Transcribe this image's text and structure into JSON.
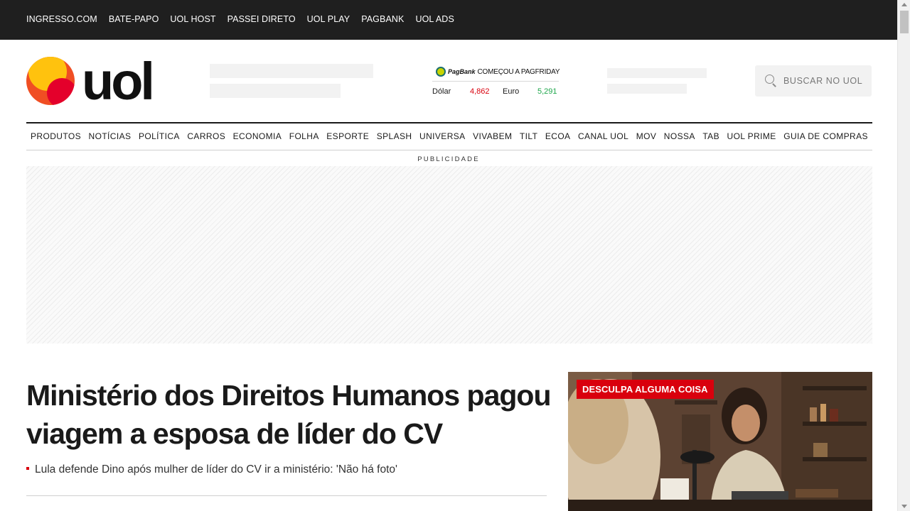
{
  "topbar": {
    "links": [
      "INGRESSO.COM",
      "BATE-PAPO",
      "UOL HOST",
      "PASSEI DIRETO",
      "UOL PLAY",
      "PAGBANK",
      "UOL ADS"
    ]
  },
  "logo": {
    "text": "uol",
    "icon": "uol-sun-logo-icon"
  },
  "ticker": {
    "promo_brand": "PagBank",
    "promo_text": "COMEÇOU A PAGFRIDAY",
    "dolar_label": "Dólar",
    "dolar_value": "4,862",
    "dolar_trend": "down",
    "euro_label": "Euro",
    "euro_value": "5,291",
    "euro_trend": "up"
  },
  "search": {
    "placeholder": "BUSCAR NO UOL",
    "icon": "search-icon"
  },
  "nav": {
    "items": [
      "PRODUTOS",
      "NOTÍCIAS",
      "POLÍTICA",
      "CARROS",
      "ECONOMIA",
      "FOLHA",
      "ESPORTE",
      "SPLASH",
      "UNIVERSA",
      "VIVABEM",
      "TILT",
      "ECOA",
      "CANAL UOL",
      "MOV",
      "NOSSA",
      "TAB",
      "UOL PRIME",
      "GUIA DE COMPRAS"
    ]
  },
  "ad": {
    "label": "PUBLICIDADE"
  },
  "main": {
    "headline": "Ministério dos Direitos Humanos pagou viagem a esposa de líder do CV",
    "related": "Lula defende Dino após mulher de líder do CV ir a ministério: 'Não há foto'"
  },
  "feature": {
    "tag": "DESCULPA ALGUMA COISA"
  },
  "colors": {
    "accent_red": "#d9000d",
    "up_green": "#1ea64b",
    "topbar_bg": "#1f1f1f"
  }
}
